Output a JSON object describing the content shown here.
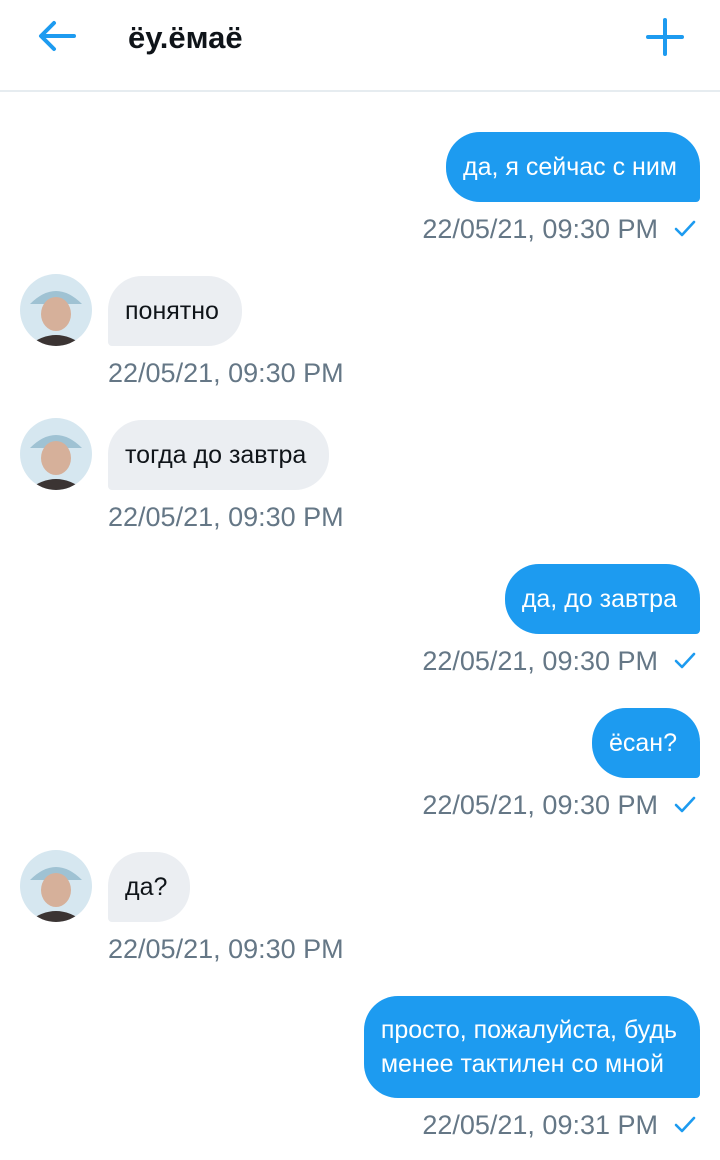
{
  "header": {
    "title": "ёу.ёмаё"
  },
  "colors": {
    "accent": "#1d9bf0",
    "incoming_bubble": "#ebeef2",
    "timestamp": "#657786"
  },
  "icons": {
    "back": "arrow-left-icon",
    "new": "plus-icon",
    "sent": "checkmark-icon"
  },
  "messages": [
    {
      "direction": "out",
      "text": "да, я сейчас с ним",
      "time": "22/05/21, 09:30 PM"
    },
    {
      "direction": "in",
      "text": "понятно",
      "time": "22/05/21, 09:30 PM"
    },
    {
      "direction": "in",
      "text": "тогда до завтра",
      "time": "22/05/21, 09:30 PM"
    },
    {
      "direction": "out",
      "text": "да, до завтра",
      "time": "22/05/21, 09:30 PM"
    },
    {
      "direction": "out",
      "text": "ёсан?",
      "time": "22/05/21, 09:30 PM"
    },
    {
      "direction": "in",
      "text": "да?",
      "time": "22/05/21, 09:30 PM"
    },
    {
      "direction": "out",
      "text_lines": [
        "просто, пожалуйста, будь",
        "менее тактилен со мной"
      ],
      "time": "22/05/21, 09:31 PM"
    }
  ]
}
